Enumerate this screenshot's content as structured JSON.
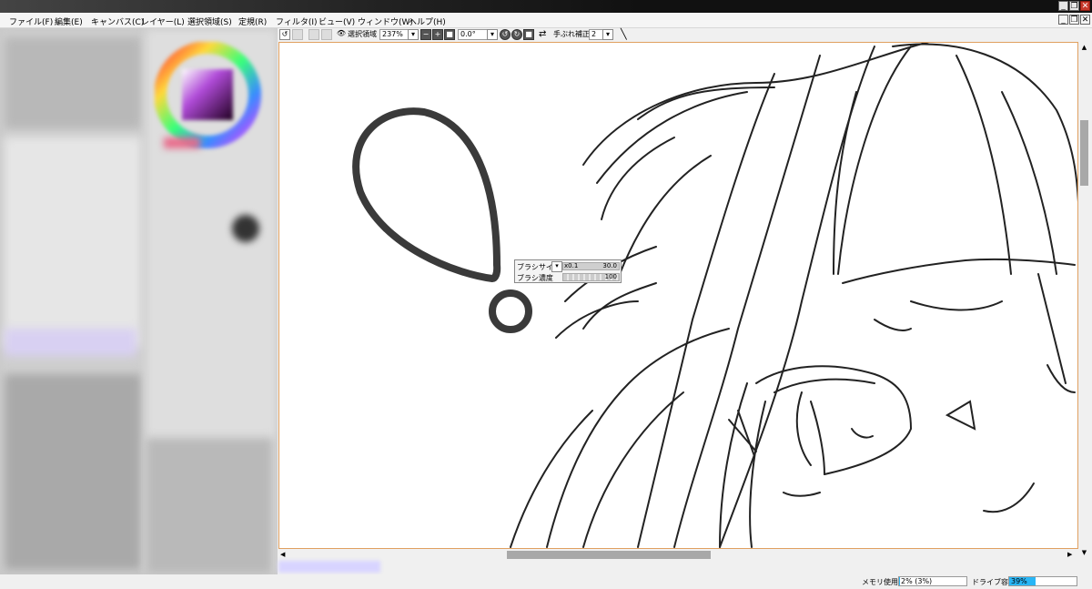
{
  "window": {
    "minimize_icon": "_",
    "restore_icon": "❐",
    "close_icon": "✕"
  },
  "menu": [
    "ファイル(F)",
    "編集(E)",
    "キャンバス(C)",
    "レイヤー(L)",
    "選択領域(S)",
    "定規(R)",
    "フィルタ(I)",
    "ビュー(V)",
    "ウィンドウ(W)",
    "ヘルプ(H)"
  ],
  "toolbar": {
    "selection_label": "選択領域",
    "zoom_value": "237%",
    "rotation_value": "0.0°",
    "stabilizer_label": "手ぶれ補正",
    "stabilizer_value": "2"
  },
  "brush_popup": {
    "size_label": "ブラシサイズ",
    "size_multiplier": "x0.1",
    "size_value": "30.0",
    "density_label": "ブラシ濃度",
    "density_value": "100"
  },
  "status": {
    "memory_label": "メモリ使用量",
    "memory_value": "2% (3%)",
    "memory_fraction": 0.02,
    "drive_label": "ドライブ容量",
    "drive_value": "39%",
    "drive_fraction": 0.39
  },
  "colors": {
    "accent_canvas_border": "#e0a060",
    "drive_bar": "#29b6f6",
    "title_bar": "#111111"
  }
}
